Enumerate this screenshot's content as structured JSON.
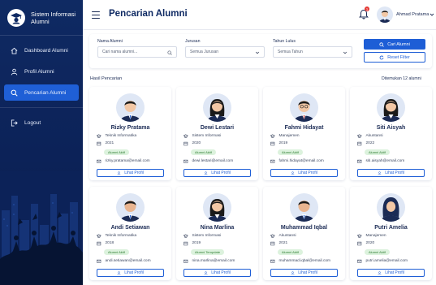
{
  "app": {
    "name_line1": "Sistem Informasi",
    "name_line2": "Alumni"
  },
  "sidebar": {
    "items": [
      {
        "label": "Dashboard Alumni",
        "icon": "home-icon",
        "active": false
      },
      {
        "label": "Profil Alumni",
        "icon": "user-icon",
        "active": false
      },
      {
        "label": "Pencarian Alumni",
        "icon": "search-icon",
        "active": true
      }
    ],
    "logout_label": "Logout"
  },
  "header": {
    "title": "Pencarian Alumni",
    "notification_count": "1",
    "user_name": "Ahmad Pratama"
  },
  "filters": {
    "name_label": "Nama Alumni",
    "name_placeholder": "Cari nama alumni...",
    "jurusan_label": "Jurusan",
    "jurusan_value": "Semua Jurusan",
    "tahun_label": "Tahun Lulus",
    "tahun_value": "Semua Tahun",
    "search_button": "Cari Alumni",
    "reset_button": "Reset Filter"
  },
  "results": {
    "title": "Hasil Pencarian",
    "count_text": "Ditemukan 12 alumni"
  },
  "cards": [
    {
      "name": "Rizky Pratama",
      "jurusan": "Teknik Informatika",
      "year": "2021",
      "status": "Alumni Aktif",
      "email": "rizky.pratama@email.com",
      "gender": "m",
      "button": "Lihat Profil"
    },
    {
      "name": "Dewi Lestari",
      "jurusan": "Sistem Informasi",
      "year": "2020",
      "status": "Alumni Aktif",
      "email": "dewi.lestari@email.com",
      "gender": "f",
      "button": "Lihat Profil"
    },
    {
      "name": "Fahmi Hidayat",
      "jurusan": "Manajemen",
      "year": "2019",
      "status": "Alumni Aktif",
      "email": "fahmi.hidayat@email.com",
      "gender": "m",
      "button": "Lihat Profil"
    },
    {
      "name": "Siti Aisyah",
      "jurusan": "Akuntansi",
      "year": "2022",
      "status": "Alumni Aktif",
      "email": "siti.aisyah@email.com",
      "gender": "f",
      "button": "Lihat Profil"
    },
    {
      "name": "Andi Setiawan",
      "jurusan": "Teknik Informatika",
      "year": "2018",
      "status": "Alumni Aktif",
      "email": "andi.setiawan@email.com",
      "gender": "m",
      "button": "Lihat Profil"
    },
    {
      "name": "Nina Marlina",
      "jurusan": "Sistem Informasi",
      "year": "2019",
      "status": "Alumni Terupdate",
      "email": "nina.marlina@email.com",
      "gender": "f",
      "button": "Lihat Profil"
    },
    {
      "name": "Muhammad Iqbal",
      "jurusan": "Akuntansi",
      "year": "2021",
      "status": "Alumni Aktif",
      "email": "muhammad.iqbal@email.com",
      "gender": "m",
      "button": "Lihat Profil"
    },
    {
      "name": "Putri Amelia",
      "jurusan": "Manajemen",
      "year": "2020",
      "status": "Alumni Aktif",
      "email": "putri.amelia@email.com",
      "gender": "h",
      "button": "Lihat Profil"
    }
  ],
  "colors": {
    "sidebar_bg": "#0f2a63",
    "accent": "#1e5ed6",
    "status_green": "#2e7d32",
    "status_bg": "#dcf2dd",
    "notification": "#e53935"
  }
}
